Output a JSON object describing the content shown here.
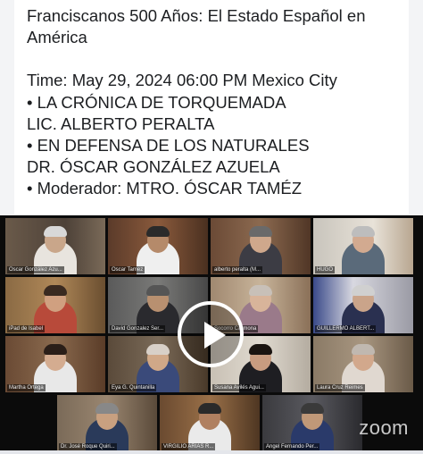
{
  "post": {
    "title": "Franciscanos 500 Años: El Estado  Español en América",
    "time": "Time: May 29, 2024 06:00 PM Mexico City",
    "item1": "• LA CRÓNICA DE TORQUEMADA",
    "item1_speaker": "LIC. ALBERTO PERALTA",
    "item2": "• EN DEFENSA DE LOS NATURALES",
    "item2_speaker": "DR. ÓSCAR GONZÁLEZ AZUELA",
    "moderator": "• Moderador: MTRO. ÓSCAR TAMÉZ"
  },
  "video": {
    "brand": "zoom",
    "participants": [
      {
        "name": "Óscar González Azu..."
      },
      {
        "name": "Óscar Tamez"
      },
      {
        "name": "alberto peralta (M..."
      },
      {
        "name": "HUGO"
      },
      {
        "name": "iPad de Isabel"
      },
      {
        "name": "David Gonzalez Ser..."
      },
      {
        "name": "Socorro Carmona"
      },
      {
        "name": "GUILLERMO ALBERT..."
      },
      {
        "name": "Martha Ortega"
      },
      {
        "name": "Eya G. Quintanilla"
      },
      {
        "name": "Susana Avilés Agui..."
      },
      {
        "name": "Laura Cruz Reimes"
      },
      {
        "name": "Dr. José Roque Quiri..."
      },
      {
        "name": "VIRGILIO ARIAS R..."
      },
      {
        "name": "Angel Fernando Per..."
      }
    ],
    "colors": {
      "active_speaker_border": "#86c232",
      "background": "#0b0b0b"
    }
  }
}
